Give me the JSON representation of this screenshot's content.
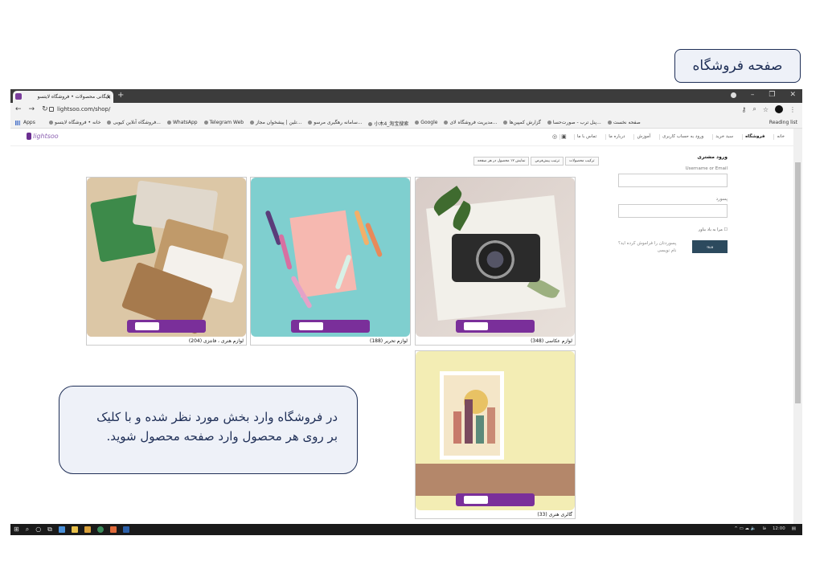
{
  "slide_title": "صفحه فروشگاه",
  "callout": {
    "line1": "در فروشگاه وارد بخش مورد نظر شده و با کلیک",
    "line2": "بر روی هر محصول  وارد صفحه محصول شوید."
  },
  "browser": {
    "tab_title": "بایگانی محصولات • فروشگاه لایتسو",
    "url": "lightsoo.com/shop/",
    "bookmarks": {
      "apps": "Apps",
      "items": [
        "خانه • فروشگاه لایتسو",
        "فروشگاه آنلاین کیوبی...",
        "WhatsApp",
        "Telegram Web",
        "تلین | پیشخوان مجاز...",
        "سامانه رهگیری مرسو...",
        "小木4_淘宝搜索",
        "Google",
        "مدیریت فروشگاه لای...",
        "گزارش کمپین‌ها",
        "پنل ترب - صورت‌حسا...",
        "صفحه نخست"
      ],
      "reading_list": "Reading list"
    }
  },
  "site": {
    "logo": "lightsoo",
    "menu": [
      "خانه",
      "فروشگاه",
      "سبد خرید",
      "ورود به حساب کاربری",
      "آموزش",
      "درباره ما",
      "تماس با ما"
    ],
    "sort": {
      "count": "نمایش ۱۲ محصول در هر صفحه",
      "order": "ترتیب پیش‌فرض",
      "label": "ترکیب محصولات"
    },
    "products": [
      {
        "label": "لوازم عکاسی (348)"
      },
      {
        "label": "لوازم تحریر (188)"
      },
      {
        "label": "لوازم هنری ، فانتزی (204)"
      },
      {
        "label": "گالری هنری (33)"
      }
    ],
    "account": {
      "title": "ورود مشتری",
      "username_label": "Username or Email",
      "password_label": "پسورد",
      "remember": "مرا به یاد بیاور",
      "login": "ورود",
      "forgot": "پسوردتان را فراموش کرده اید؟",
      "register": "نام نویسی"
    }
  },
  "taskbar": {
    "time": "12:00",
    "lang": "فا"
  }
}
